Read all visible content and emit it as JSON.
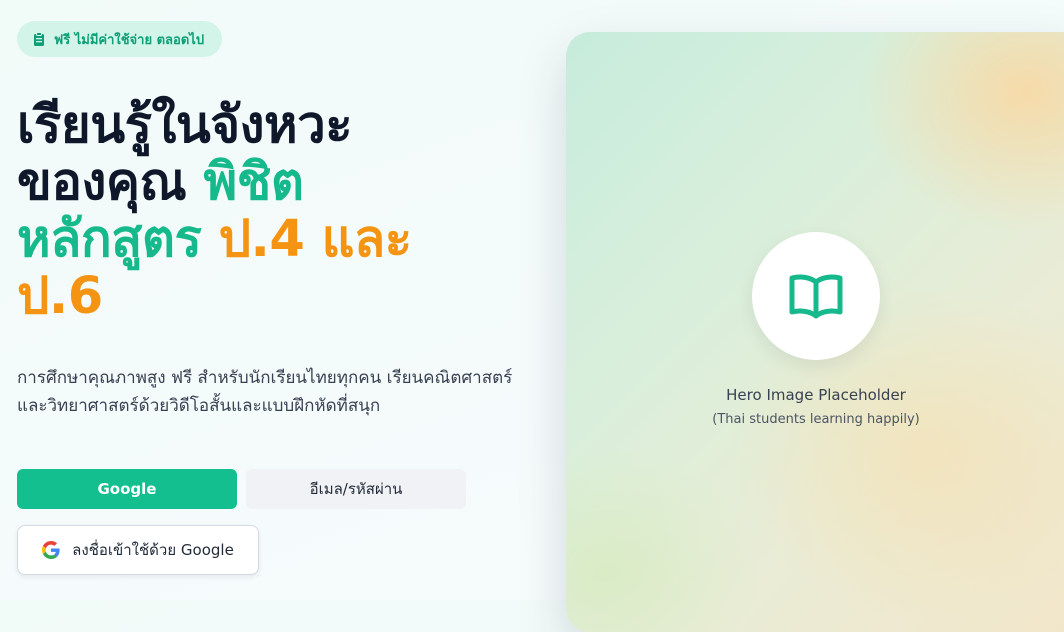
{
  "badge": {
    "icon": "clipboard-icon",
    "text": "ฟรี ไม่มีค่าใช้จ่าย ตลอดไป"
  },
  "hero": {
    "line1": "เรียนรู้ในจังหวะ",
    "line2_dark": "ของคุณ",
    "line2_green": "พิชิต",
    "line3_green": "หลักสูตร",
    "line3_orange": "ป.4 และ",
    "line4_orange": "ป.6"
  },
  "description": "การศึกษาคุณภาพสูง ฟรี สำหรับนักเรียนไทยทุกคน เรียนคณิตศาสตร์และวิทยาศาสตร์ด้วยวิดีโอสั้นและแบบฝึกหัดที่สนุก",
  "tabs": [
    {
      "label": "Google",
      "active": true
    },
    {
      "label": "อีเมล/รหัสผ่าน",
      "active": false
    }
  ],
  "google_signin": {
    "label": "ลงชื่อเข้าใช้ด้วย Google",
    "icon": "google-icon"
  },
  "hero_image": {
    "icon": "book-icon",
    "title": "Hero Image Placeholder",
    "subtitle": "(Thai students learning happily)"
  },
  "colors": {
    "accent_green": "#14bf8f",
    "accent_orange": "#f59412",
    "text_dark": "#0f172a"
  }
}
